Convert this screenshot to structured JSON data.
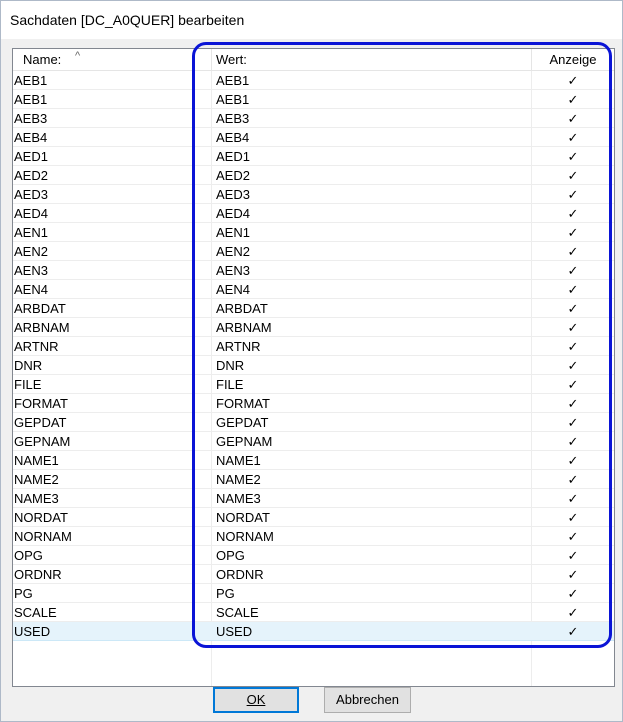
{
  "window": {
    "title": "Sachdaten [DC_A0QUER] bearbeiten"
  },
  "columns": {
    "name": "Name:",
    "wert": "Wert:",
    "anzeige": "Anzeige"
  },
  "sort_indicator": "^",
  "check_symbol": "✓",
  "rows": [
    {
      "name": "AEB1",
      "wert": "AEB1",
      "anzeige": true
    },
    {
      "name": "AEB1",
      "wert": "AEB1",
      "anzeige": true
    },
    {
      "name": "AEB3",
      "wert": "AEB3",
      "anzeige": true
    },
    {
      "name": "AEB4",
      "wert": "AEB4",
      "anzeige": true
    },
    {
      "name": "AED1",
      "wert": "AED1",
      "anzeige": true
    },
    {
      "name": "AED2",
      "wert": "AED2",
      "anzeige": true
    },
    {
      "name": "AED3",
      "wert": "AED3",
      "anzeige": true
    },
    {
      "name": "AED4",
      "wert": "AED4",
      "anzeige": true
    },
    {
      "name": "AEN1",
      "wert": "AEN1",
      "anzeige": true
    },
    {
      "name": "AEN2",
      "wert": "AEN2",
      "anzeige": true
    },
    {
      "name": "AEN3",
      "wert": "AEN3",
      "anzeige": true
    },
    {
      "name": "AEN4",
      "wert": "AEN4",
      "anzeige": true
    },
    {
      "name": "ARBDAT",
      "wert": "ARBDAT",
      "anzeige": true
    },
    {
      "name": "ARBNAM",
      "wert": "ARBNAM",
      "anzeige": true
    },
    {
      "name": "ARTNR",
      "wert": "ARTNR",
      "anzeige": true
    },
    {
      "name": "DNR",
      "wert": "DNR",
      "anzeige": true
    },
    {
      "name": "FILE",
      "wert": "FILE",
      "anzeige": true
    },
    {
      "name": "FORMAT",
      "wert": "FORMAT",
      "anzeige": true
    },
    {
      "name": "GEPDAT",
      "wert": "GEPDAT",
      "anzeige": true
    },
    {
      "name": "GEPNAM",
      "wert": "GEPNAM",
      "anzeige": true
    },
    {
      "name": "NAME1",
      "wert": "NAME1",
      "anzeige": true
    },
    {
      "name": "NAME2",
      "wert": "NAME2",
      "anzeige": true
    },
    {
      "name": "NAME3",
      "wert": "NAME3",
      "anzeige": true
    },
    {
      "name": "NORDAT",
      "wert": "NORDAT",
      "anzeige": true
    },
    {
      "name": "NORNAM",
      "wert": "NORNAM",
      "anzeige": true
    },
    {
      "name": "OPG",
      "wert": "OPG",
      "anzeige": true
    },
    {
      "name": "ORDNR",
      "wert": "ORDNR",
      "anzeige": true
    },
    {
      "name": "PG",
      "wert": "PG",
      "anzeige": true
    },
    {
      "name": "SCALE",
      "wert": "SCALE",
      "anzeige": true
    },
    {
      "name": "USED",
      "wert": "USED",
      "anzeige": true,
      "selected": true
    }
  ],
  "buttons": {
    "ok": "OK",
    "cancel": "Abbrechen"
  },
  "colors": {
    "highlight": "#0a14d6",
    "selected_row": "#e5f3fb",
    "default_button_border": "#0078d7"
  }
}
